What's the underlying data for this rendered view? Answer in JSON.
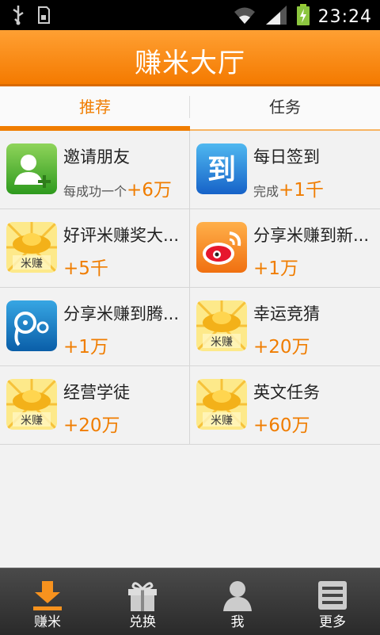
{
  "status_bar": {
    "time": "23:24",
    "icons": [
      "usb-icon",
      "sd-card-icon",
      "wifi-icon",
      "signal-icon",
      "battery-charging-icon"
    ]
  },
  "header": {
    "title": "赚米大厅"
  },
  "tabs": [
    {
      "label": "推荐",
      "active": true
    },
    {
      "label": "任务",
      "active": false
    }
  ],
  "tasks": [
    {
      "name": "邀请朋友",
      "desc": "每成功一个",
      "reward": "+6万",
      "icon": "invite-friend-icon"
    },
    {
      "name": "每日签到",
      "desc": "完成",
      "reward": "+1千",
      "icon": "daily-checkin-icon"
    },
    {
      "name": "好评米赚奖大...",
      "desc": "",
      "reward": "+5千",
      "icon": "mizhuan-gold-icon"
    },
    {
      "name": "分享米赚到新...",
      "desc": "",
      "reward": "+1万",
      "icon": "weibo-icon"
    },
    {
      "name": "分享米赚到腾...",
      "desc": "",
      "reward": "+1万",
      "icon": "tencent-weibo-icon"
    },
    {
      "name": "幸运竞猜",
      "desc": "",
      "reward": "+20万",
      "icon": "mizhuan-gold-icon"
    },
    {
      "name": "经营学徒",
      "desc": "",
      "reward": "+20万",
      "icon": "mizhuan-gold-icon"
    },
    {
      "name": "英文任务",
      "desc": "",
      "reward": "+60万",
      "icon": "mizhuan-gold-icon"
    }
  ],
  "icon_text": {
    "mizhuan": "米赚",
    "checkin": "到"
  },
  "bottom_nav": [
    {
      "label": "赚米",
      "icon": "download-icon",
      "active": true
    },
    {
      "label": "兑换",
      "icon": "gift-icon",
      "active": false
    },
    {
      "label": "我",
      "icon": "user-icon",
      "active": false
    },
    {
      "label": "更多",
      "icon": "menu-list-icon",
      "active": false
    }
  ],
  "colors": {
    "accent": "#f07d00",
    "header": "#f7870d",
    "bottom_bar": "#333333"
  }
}
